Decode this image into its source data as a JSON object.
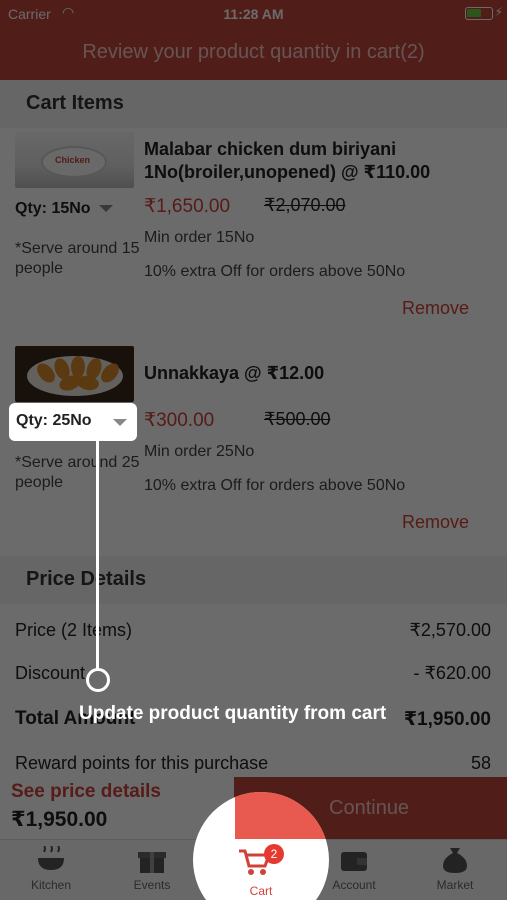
{
  "status_bar": {
    "carrier": "Carrier",
    "time": "11:28 AM"
  },
  "header": {
    "title": "Review your product quantity in cart(2)"
  },
  "cart": {
    "section_title": "Cart Items",
    "items": [
      {
        "name": "Malabar chicken dum biriyani 1No(broiler,unopened) @ ₹110.00",
        "qty_label": "Qty: 15No",
        "serve": "*Serve around 15 people",
        "price": "₹1,650.00",
        "old_price": "₹2,070.00",
        "min_order": "Min order 15No",
        "offer": "10% extra Off for orders above 50No",
        "remove_label": "Remove",
        "image_text": "Chicken"
      },
      {
        "name": "Unnakkaya @ ₹12.00",
        "qty_label": "Qty: 25No",
        "serve": "*Serve around 25 people",
        "price": "₹300.00",
        "old_price": "₹500.00",
        "min_order": "Min order 25No",
        "offer": "10% extra Off for orders above 50No",
        "remove_label": "Remove"
      }
    ]
  },
  "price_details": {
    "section_title": "Price Details",
    "price_label": "Price (2 Items)",
    "price_value": "₹2,570.00",
    "discount_label": "Discount",
    "discount_value": "- ₹620.00",
    "total_label": "Total Amount",
    "total_value": "₹1,950.00",
    "reward_label": "Reward points for this purchase",
    "reward_value": "58"
  },
  "footer": {
    "see_details": "See price details",
    "total": "₹1,950.00",
    "continue_label": "Continue"
  },
  "tabs": [
    {
      "label": "Kitchen",
      "icon": "kitchen-icon"
    },
    {
      "label": "Events",
      "icon": "gift-icon"
    },
    {
      "label": "Cart",
      "icon": "cart-icon",
      "badge": "2"
    },
    {
      "label": "Account",
      "icon": "wallet-icon"
    },
    {
      "label": "Market",
      "icon": "sack-icon"
    }
  ],
  "coach_mark": {
    "text": "Update product quantity from cart"
  },
  "colors": {
    "brand": "#c0463d",
    "accent_red": "#d0413a",
    "badge": "#e53a30"
  }
}
